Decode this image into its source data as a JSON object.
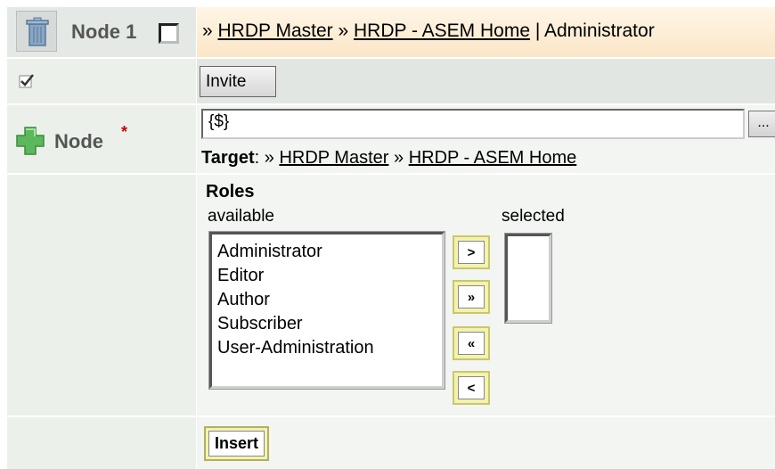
{
  "header": {
    "node_label": "Node 1",
    "breadcrumb_prefix": "» ",
    "breadcrumb_link1": "HRDP Master",
    "breadcrumb_sep": " » ",
    "breadcrumb_link2": "HRDP - ASEM Home",
    "breadcrumb_suffix": " | Administrator"
  },
  "toolbar": {
    "invite_label": "Invite"
  },
  "node_field": {
    "label": "Node",
    "required_mark": "*",
    "value": "{$}",
    "browse_label": "...",
    "target_prefix": "Target",
    "target_colon": ": » ",
    "target_link1": "HRDP Master",
    "target_sep": " » ",
    "target_link2": "HRDP - ASEM Home"
  },
  "roles": {
    "title": "Roles",
    "available_label": "available",
    "selected_label": "selected",
    "available": [
      "Administrator",
      "Editor",
      "Author",
      "Subscriber",
      "User-Administration"
    ],
    "buttons": {
      "move_one": ">",
      "move_all": "»",
      "remove_all": "«",
      "remove_one": "<"
    }
  },
  "footer": {
    "insert_label": "Insert"
  },
  "icons": {
    "delete": "trash-icon",
    "add": "plus-icon",
    "check": "checkmark-icon"
  },
  "colors": {
    "header_bg": "#fbe6c7",
    "button_accent": "#f4f2b0",
    "required": "#cc0000",
    "plus_green": "#4caf50"
  }
}
